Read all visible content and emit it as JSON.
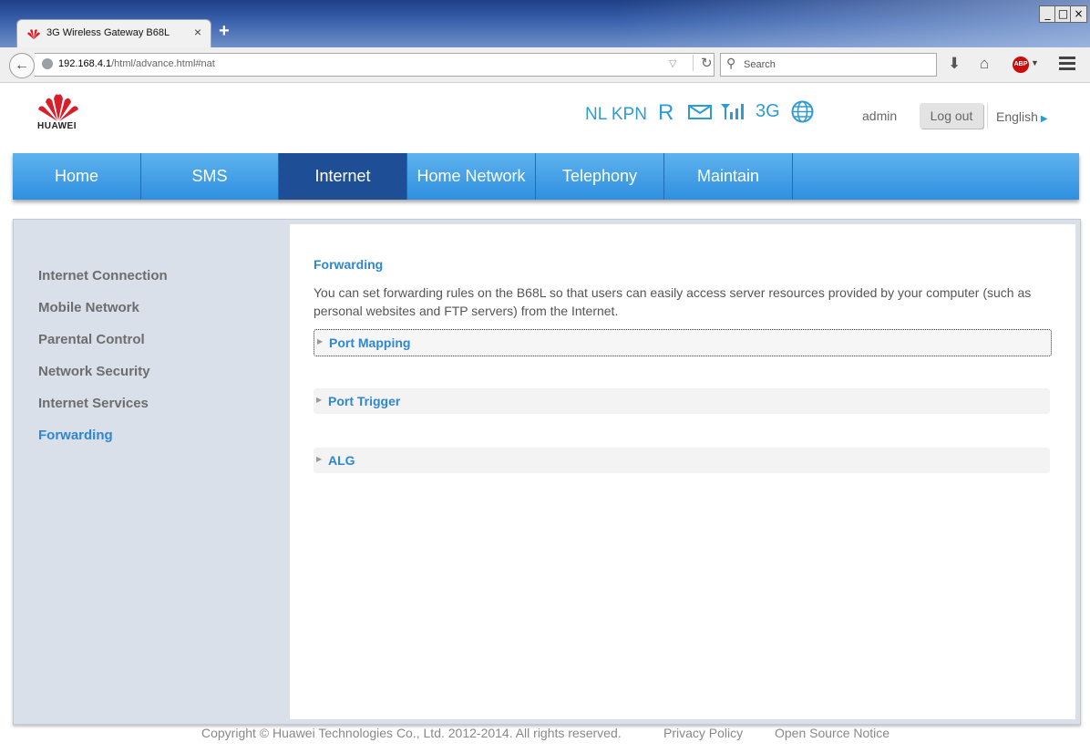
{
  "browser": {
    "tab_title": "3G Wireless Gateway B68L",
    "tab_close": "×",
    "new_tab": "+",
    "url_host": "192.168.4.1",
    "url_path": "/html/advance.html#nat",
    "search_placeholder": "Search",
    "window_buttons": [
      "_",
      "□",
      "×"
    ]
  },
  "header": {
    "brand": "HUAWEI",
    "status": {
      "operator": "NL KPN",
      "roaming": "R",
      "network_type": "3G"
    },
    "user": "admin",
    "logout_label": "Log out",
    "language": "English"
  },
  "nav": [
    {
      "label": "Home"
    },
    {
      "label": "SMS"
    },
    {
      "label": "Internet",
      "active": true
    },
    {
      "label": "Home Network"
    },
    {
      "label": "Telephony"
    },
    {
      "label": "Maintain"
    }
  ],
  "sidebar": {
    "items": [
      {
        "label": "Internet Connection"
      },
      {
        "label": "Mobile Network"
      },
      {
        "label": "Parental Control"
      },
      {
        "label": "Network Security"
      },
      {
        "label": "Internet Services"
      },
      {
        "label": "Forwarding",
        "active": true
      }
    ]
  },
  "main": {
    "title": "Forwarding",
    "description": "You can set forwarding rules on the B68L so that users can easily access server resources provided by your computer (such as personal websites and FTP servers) from the Internet.",
    "sections": [
      {
        "label": "Port Mapping"
      },
      {
        "label": "Port Trigger"
      },
      {
        "label": "ALG"
      }
    ]
  },
  "footer": {
    "copyright": "Copyright © Huawei Technologies Co., Ltd. 2012-2014. All rights reserved.",
    "privacy": "Privacy Policy",
    "open_source": "Open Source Notice"
  },
  "colors": {
    "accent": "#2f87d0",
    "nav_active": "#1e4f96",
    "nav_bg": "#2f8fe0"
  }
}
